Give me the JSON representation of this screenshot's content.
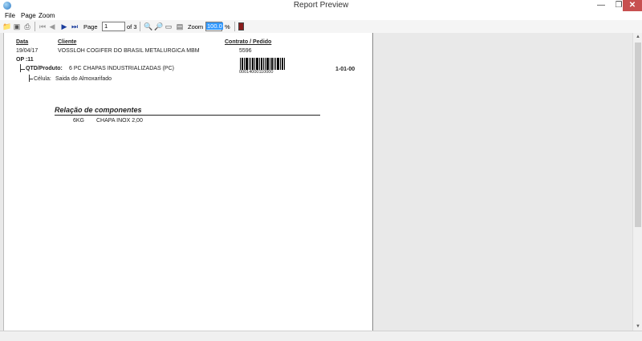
{
  "window": {
    "title": "Report Preview"
  },
  "menu": {
    "file": "File",
    "page": "Page",
    "zoom": "Zoom"
  },
  "toolbar": {
    "page_label": "Page",
    "page_value": "1",
    "of_label": "of 3",
    "zoom_label": "Zoom",
    "zoom_value": "100.0",
    "percent": "%"
  },
  "report": {
    "headers": {
      "data": "Data",
      "cliente": "Cliente",
      "contrato": "Contrato / Pedido"
    },
    "row": {
      "date": "19/04/17",
      "client": "VOSSLOH COGIFER DO BRASIL METALURGICA MBM",
      "contract": "5596",
      "barcode_text": "00014000110000",
      "code": "1-01-00"
    },
    "op": "OP :11",
    "qtd_label": "QTD/Produto:",
    "qtd_value": "6 PC CHAPAS INDUSTRIALIZADAS (PC)",
    "celula_label": "Célula:",
    "celula_value": "Saida do Almoxarifado",
    "section_title": "Relação de componentes",
    "components": [
      {
        "qty": "6KG",
        "desc": "CHAPA INOX 2,00"
      }
    ]
  },
  "colors": {
    "close_button": "#c75050",
    "selection": "#3399ff",
    "background": "#e9e9e9"
  }
}
